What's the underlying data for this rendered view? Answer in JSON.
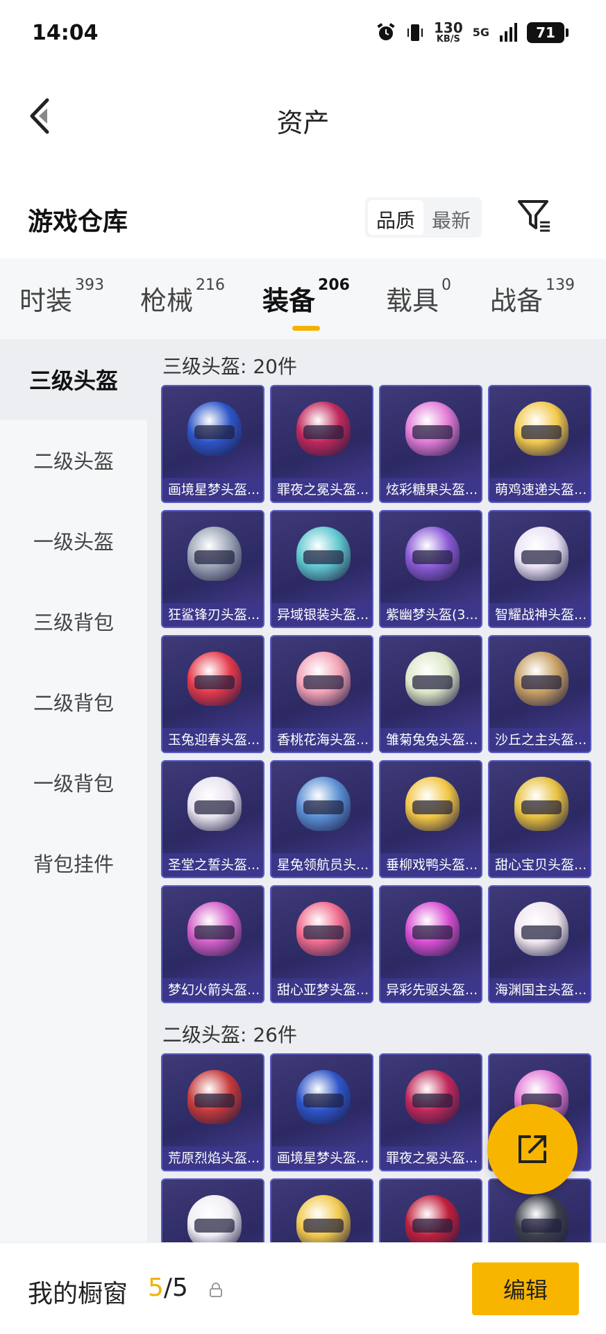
{
  "status_bar": {
    "time": "14:04",
    "net_speed": "130",
    "net_unit": "KB/S",
    "network": "5G",
    "battery": "71"
  },
  "header": {
    "title": "资产"
  },
  "warehouse": {
    "title": "游戏仓库",
    "sort_options": [
      "品质",
      "最新"
    ],
    "selected_sort": "品质"
  },
  "tabs": [
    {
      "label": "时装",
      "count": "393"
    },
    {
      "label": "枪械",
      "count": "216"
    },
    {
      "label": "装备",
      "count": "206"
    },
    {
      "label": "载具",
      "count": "0"
    },
    {
      "label": "战备",
      "count": "139"
    }
  ],
  "active_tab": "装备",
  "sidebar": {
    "items": [
      "三级头盔",
      "二级头盔",
      "一级头盔",
      "三级背包",
      "二级背包",
      "一级背包",
      "背包挂件"
    ],
    "active": "三级头盔"
  },
  "sections": [
    {
      "title": "三级头盔: 20件",
      "items": [
        {
          "name": "画境星梦头盔...",
          "color": "#2d55c8"
        },
        {
          "name": "罪夜之冕头盔...",
          "color": "#c0285a"
        },
        {
          "name": "炫彩糖果头盔...",
          "color": "#e27ad6"
        },
        {
          "name": "萌鸡速递头盔...",
          "color": "#f2c94c"
        },
        {
          "name": "狂鲨锋刃头盔...",
          "color": "#9aa3b5"
        },
        {
          "name": "异域银装头盔...",
          "color": "#5fc7cf"
        },
        {
          "name": "紫幽梦头盔(3...",
          "color": "#8a5bd6"
        },
        {
          "name": "智耀战神头盔...",
          "color": "#e9e2f5"
        },
        {
          "name": "玉兔迎春头盔...",
          "color": "#e5394a"
        },
        {
          "name": "香桃花海头盔...",
          "color": "#f4a3b6"
        },
        {
          "name": "雏菊兔兔头盔...",
          "color": "#dde8c8"
        },
        {
          "name": "沙丘之主头盔...",
          "color": "#c7a064"
        },
        {
          "name": "圣堂之誓头盔...",
          "color": "#e8e3ee"
        },
        {
          "name": "星兔领航员头...",
          "color": "#5a8fd4"
        },
        {
          "name": "垂柳戏鸭头盔...",
          "color": "#f2c744"
        },
        {
          "name": "甜心宝贝头盔...",
          "color": "#e7c13e"
        },
        {
          "name": "梦幻火箭头盔...",
          "color": "#d35fc8"
        },
        {
          "name": "甜心亚梦头盔...",
          "color": "#f06b8d"
        },
        {
          "name": "异彩先驱头盔...",
          "color": "#d84fd2"
        },
        {
          "name": "海渊国主头盔...",
          "color": "#f0e6ee"
        }
      ]
    },
    {
      "title": "二级头盔: 26件",
      "items": [
        {
          "name": "荒原烈焰头盔...",
          "color": "#c73a3a"
        },
        {
          "name": "画境星梦头盔...",
          "color": "#2d55c8"
        },
        {
          "name": "罪夜之冕头盔...",
          "color": "#c0285a"
        },
        {
          "name": "",
          "color": "#e27ad6"
        },
        {
          "name": "",
          "color": "#f0eef4"
        },
        {
          "name": "",
          "color": "#f2c94c"
        },
        {
          "name": "",
          "color": "#c01f3c"
        },
        {
          "name": "",
          "color": "#3b3f4a"
        }
      ]
    }
  ],
  "showcase": {
    "label": "我的橱窗",
    "current": "5",
    "total": "5",
    "edit_label": "编辑"
  }
}
